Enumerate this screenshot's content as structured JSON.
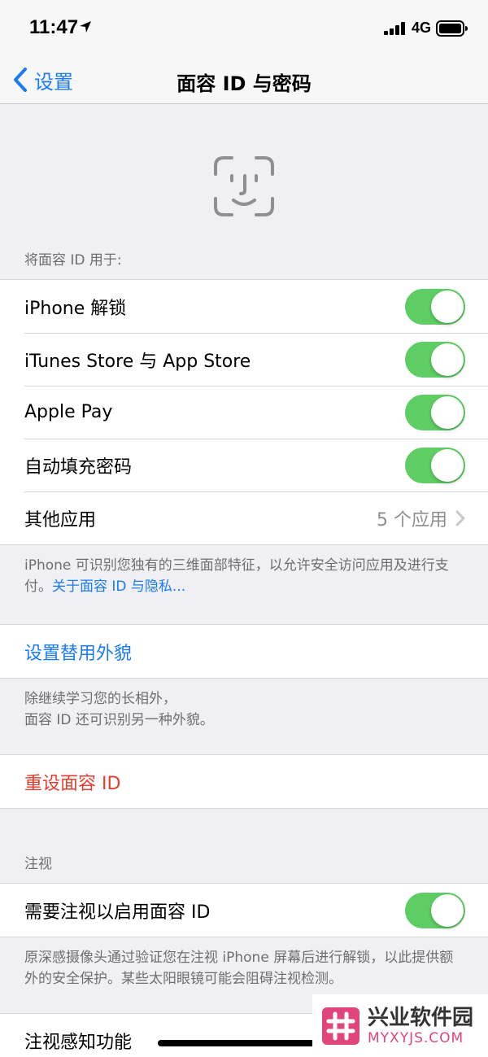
{
  "status_bar": {
    "time": "11:47",
    "network": "4G"
  },
  "nav": {
    "back_label": "设置",
    "title": "面容 ID 与密码"
  },
  "use_face_id": {
    "header": "将面容 ID 用于:",
    "rows": [
      {
        "label": "iPhone 解锁",
        "toggle_on": true
      },
      {
        "label": "iTunes Store 与 App Store",
        "toggle_on": true
      },
      {
        "label": "Apple Pay",
        "toggle_on": true
      },
      {
        "label": "自动填充密码",
        "toggle_on": true
      }
    ],
    "other_apps": {
      "label": "其他应用",
      "value": "5 个应用"
    },
    "footer": "iPhone 可识别您独有的三维面部特征，以允许安全访问应用及进行支付。",
    "footer_link": "关于面容 ID 与隐私..."
  },
  "alternate_appearance": {
    "label": "设置替用外貌",
    "footer_line1": "除继续学习您的长相外，",
    "footer_line2": "面容 ID 还可识别另一种外貌。"
  },
  "reset": {
    "label": "重设面容 ID"
  },
  "attention": {
    "header": "注视",
    "require_label": "需要注视以启用面容 ID",
    "require_on": true,
    "footer": "原深感摄像头通过验证您在注视 iPhone 屏幕后进行解锁，以此提供额外的安全保护。某些太阳眼镜可能会阻碍注视检测。",
    "aware_label": "注视感知功能"
  },
  "watermark": {
    "title": "兴业软件园",
    "subtitle": "MYXYJS.COM"
  },
  "colors": {
    "accent": "#1a7bf2",
    "destructive": "#e53d2f",
    "toggle_on": "#5ece64",
    "background": "#efeff4"
  }
}
